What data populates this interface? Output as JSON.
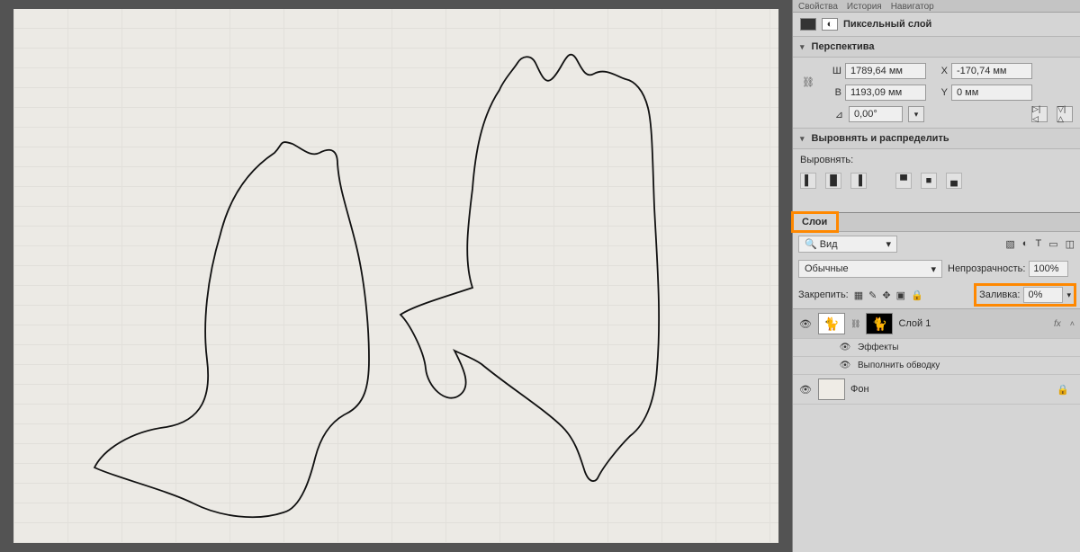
{
  "topTabs": {
    "t1": "Свойства",
    "t2": "История",
    "t3": "Навигатор"
  },
  "propsHeader": "Пиксельный слой",
  "perspective": {
    "title": "Перспектива",
    "W_label": "Ш",
    "W": "1789,64 мм",
    "H_label": "В",
    "H": "1193,09 мм",
    "X_label": "X",
    "X": "-170,74 мм",
    "Y_label": "Y",
    "Y": "0 мм",
    "angle_label": "⊿",
    "angle": "0,00°"
  },
  "align": {
    "title": "Выровнять и распределить",
    "sub": "Выровнять:"
  },
  "layers": {
    "tab": "Слои",
    "searchKind": "Вид",
    "blendMode": "Обычные",
    "opacityLabel": "Непрозрачность:",
    "opacity": "100%",
    "lockLabel": "Закрепить:",
    "fillLabel": "Заливка:",
    "fill": "0%",
    "layer1": "Слой 1",
    "effects": "Эффекты",
    "stroke": "Выполнить обводку",
    "bg": "Фон"
  }
}
